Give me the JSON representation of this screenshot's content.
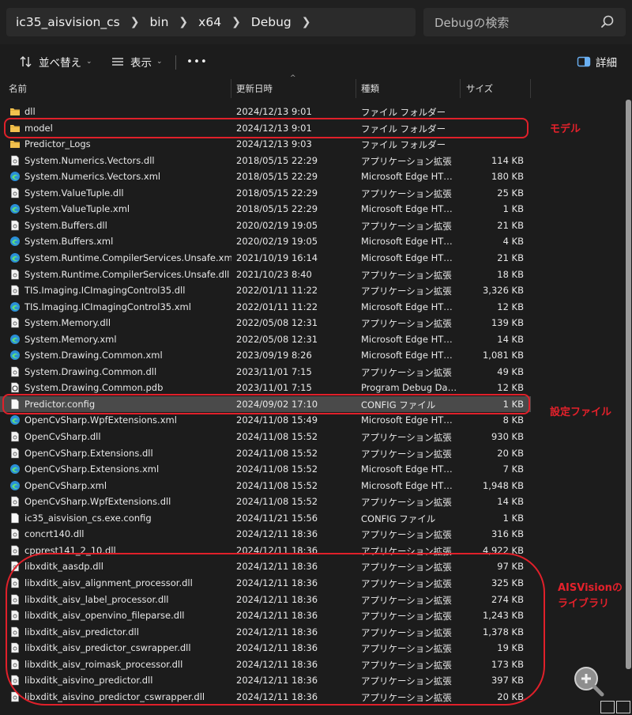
{
  "address": {
    "crumbs": [
      "ic35_aisvision_cs",
      "bin",
      "x64",
      "Debug"
    ],
    "search_placeholder": "Debugの検索"
  },
  "toolbar": {
    "sort_label": "並べ替え",
    "view_label": "表示",
    "more_label": "•••",
    "details_label": "詳細"
  },
  "columns": {
    "name": "名前",
    "date": "更新日時",
    "type": "種類",
    "size": "サイズ"
  },
  "files": [
    {
      "name": "dll",
      "date": "2024/12/13 9:01",
      "type": "ファイル フォルダー",
      "size": "",
      "icon": "folder-icon"
    },
    {
      "name": "model",
      "date": "2024/12/13 9:01",
      "type": "ファイル フォルダー",
      "size": "",
      "icon": "folder-icon"
    },
    {
      "name": "Predictor_Logs",
      "date": "2024/12/13 9:03",
      "type": "ファイル フォルダー",
      "size": "",
      "icon": "folder-icon"
    },
    {
      "name": "System.Numerics.Vectors.dll",
      "date": "2018/05/15 22:29",
      "type": "アプリケーション拡張",
      "size": "114 KB",
      "icon": "dll-file-icon"
    },
    {
      "name": "System.Numerics.Vectors.xml",
      "date": "2018/05/15 22:29",
      "type": "Microsoft Edge HTML Document",
      "size": "180 KB",
      "icon": "edge-file-icon"
    },
    {
      "name": "System.ValueTuple.dll",
      "date": "2018/05/15 22:29",
      "type": "アプリケーション拡張",
      "size": "25 KB",
      "icon": "dll-file-icon"
    },
    {
      "name": "System.ValueTuple.xml",
      "date": "2018/05/15 22:29",
      "type": "Microsoft Edge HTML Document",
      "size": "1 KB",
      "icon": "edge-file-icon"
    },
    {
      "name": "System.Buffers.dll",
      "date": "2020/02/19 19:05",
      "type": "アプリケーション拡張",
      "size": "21 KB",
      "icon": "dll-file-icon"
    },
    {
      "name": "System.Buffers.xml",
      "date": "2020/02/19 19:05",
      "type": "Microsoft Edge HTML Document",
      "size": "4 KB",
      "icon": "edge-file-icon"
    },
    {
      "name": "System.Runtime.CompilerServices.Unsafe.xml",
      "date": "2021/10/19 16:14",
      "type": "Microsoft Edge HTML Document",
      "size": "21 KB",
      "icon": "edge-file-icon"
    },
    {
      "name": "System.Runtime.CompilerServices.Unsafe.dll",
      "date": "2021/10/23 8:40",
      "type": "アプリケーション拡張",
      "size": "18 KB",
      "icon": "dll-file-icon"
    },
    {
      "name": "TIS.Imaging.ICImagingControl35.dll",
      "date": "2022/01/11 11:22",
      "type": "アプリケーション拡張",
      "size": "3,326 KB",
      "icon": "dll-file-icon"
    },
    {
      "name": "TIS.Imaging.ICImagingControl35.xml",
      "date": "2022/01/11 11:22",
      "type": "Microsoft Edge HTML Document",
      "size": "12 KB",
      "icon": "edge-file-icon"
    },
    {
      "name": "System.Memory.dll",
      "date": "2022/05/08 12:31",
      "type": "アプリケーション拡張",
      "size": "139 KB",
      "icon": "dll-file-icon"
    },
    {
      "name": "System.Memory.xml",
      "date": "2022/05/08 12:31",
      "type": "Microsoft Edge HTML Document",
      "size": "14 KB",
      "icon": "edge-file-icon"
    },
    {
      "name": "System.Drawing.Common.xml",
      "date": "2023/09/19 8:26",
      "type": "Microsoft Edge HTML Document",
      "size": "1,081 KB",
      "icon": "edge-file-icon"
    },
    {
      "name": "System.Drawing.Common.dll",
      "date": "2023/11/01 7:15",
      "type": "アプリケーション拡張",
      "size": "49 KB",
      "icon": "dll-file-icon"
    },
    {
      "name": "System.Drawing.Common.pdb",
      "date": "2023/11/01 7:15",
      "type": "Program Debug Database",
      "size": "12 KB",
      "icon": "pdb-file-icon"
    },
    {
      "name": "Predictor.config",
      "date": "2024/09/02 17:10",
      "type": "CONFIG ファイル",
      "size": "1 KB",
      "icon": "file-icon"
    },
    {
      "name": "OpenCvSharp.WpfExtensions.xml",
      "date": "2024/11/08 15:49",
      "type": "Microsoft Edge HTML Document",
      "size": "8 KB",
      "icon": "edge-file-icon"
    },
    {
      "name": "OpenCvSharp.dll",
      "date": "2024/11/08 15:52",
      "type": "アプリケーション拡張",
      "size": "930 KB",
      "icon": "dll-file-icon"
    },
    {
      "name": "OpenCvSharp.Extensions.dll",
      "date": "2024/11/08 15:52",
      "type": "アプリケーション拡張",
      "size": "20 KB",
      "icon": "dll-file-icon"
    },
    {
      "name": "OpenCvSharp.Extensions.xml",
      "date": "2024/11/08 15:52",
      "type": "Microsoft Edge HTML Document",
      "size": "7 KB",
      "icon": "edge-file-icon"
    },
    {
      "name": "OpenCvSharp.xml",
      "date": "2024/11/08 15:52",
      "type": "Microsoft Edge HTML Document",
      "size": "1,948 KB",
      "icon": "edge-file-icon"
    },
    {
      "name": "OpenCvSharp.WpfExtensions.dll",
      "date": "2024/11/08 15:52",
      "type": "アプリケーション拡張",
      "size": "14 KB",
      "icon": "dll-file-icon"
    },
    {
      "name": "ic35_aisvision_cs.exe.config",
      "date": "2024/11/21 15:56",
      "type": "CONFIG ファイル",
      "size": "1 KB",
      "icon": "file-icon"
    },
    {
      "name": "concrt140.dll",
      "date": "2024/12/11 18:36",
      "type": "アプリケーション拡張",
      "size": "316 KB",
      "icon": "dll-file-icon"
    },
    {
      "name": "cpprest141_2_10.dll",
      "date": "2024/12/11 18:36",
      "type": "アプリケーション拡張",
      "size": "4,922 KB",
      "icon": "dll-file-icon"
    },
    {
      "name": "libxditk_aasdp.dll",
      "date": "2024/12/11 18:36",
      "type": "アプリケーション拡張",
      "size": "97 KB",
      "icon": "dll-file-icon"
    },
    {
      "name": "libxditk_aisv_alignment_processor.dll",
      "date": "2024/12/11 18:36",
      "type": "アプリケーション拡張",
      "size": "325 KB",
      "icon": "dll-file-icon"
    },
    {
      "name": "libxditk_aisv_label_processor.dll",
      "date": "2024/12/11 18:36",
      "type": "アプリケーション拡張",
      "size": "274 KB",
      "icon": "dll-file-icon"
    },
    {
      "name": "libxditk_aisv_openvino_fileparse.dll",
      "date": "2024/12/11 18:36",
      "type": "アプリケーション拡張",
      "size": "1,243 KB",
      "icon": "dll-file-icon"
    },
    {
      "name": "libxditk_aisv_predictor.dll",
      "date": "2024/12/11 18:36",
      "type": "アプリケーション拡張",
      "size": "1,378 KB",
      "icon": "dll-file-icon"
    },
    {
      "name": "libxditk_aisv_predictor_cswrapper.dll",
      "date": "2024/12/11 18:36",
      "type": "アプリケーション拡張",
      "size": "19 KB",
      "icon": "dll-file-icon"
    },
    {
      "name": "libxditk_aisv_roimask_processor.dll",
      "date": "2024/12/11 18:36",
      "type": "アプリケーション拡張",
      "size": "173 KB",
      "icon": "dll-file-icon"
    },
    {
      "name": "libxditk_aisvino_predictor.dll",
      "date": "2024/12/11 18:36",
      "type": "アプリケーション拡張",
      "size": "397 KB",
      "icon": "dll-file-icon"
    },
    {
      "name": "libxditk_aisvino_predictor_cswrapper.dll",
      "date": "2024/12/11 18:36",
      "type": "アプリケーション拡張",
      "size": "20 KB",
      "icon": "dll-file-icon"
    }
  ],
  "selected_file": "Predictor.config",
  "annotations": {
    "model_note": "モデル",
    "config_note": "設定ファイル",
    "lib_note_line1": "AISVisionの",
    "lib_note_line2": "ライブラリ",
    "color": "#e0202a"
  }
}
